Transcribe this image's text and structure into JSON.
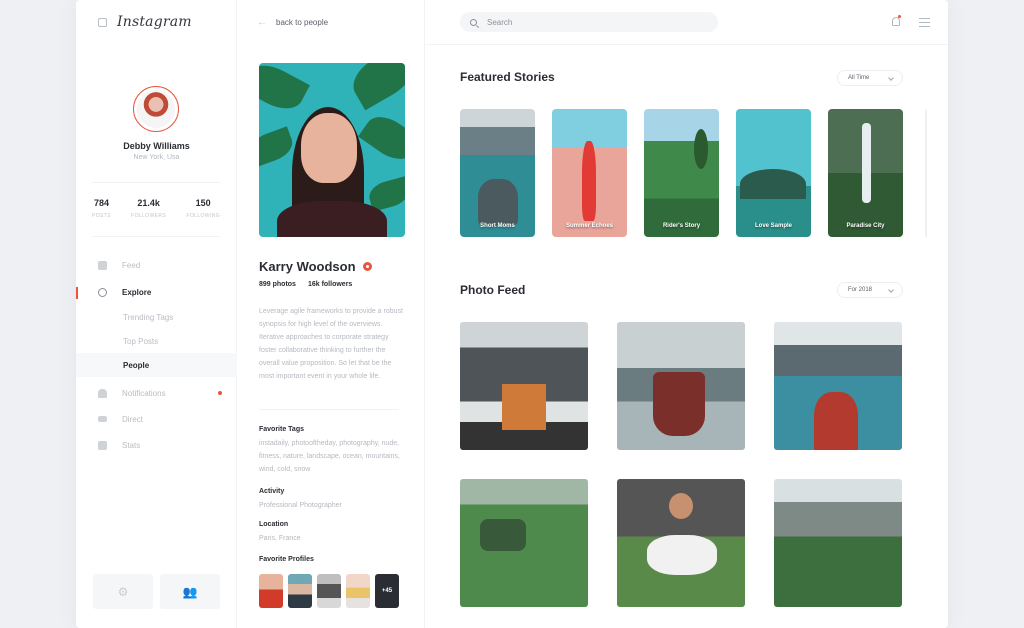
{
  "app": {
    "brand": "Instagram"
  },
  "user": {
    "name": "Debby Williams",
    "location": "New York, Usa"
  },
  "user_stats": [
    {
      "value": "784",
      "label": "POSTS"
    },
    {
      "value": "21.4k",
      "label": "FOLLOWERS"
    },
    {
      "value": "150",
      "label": "FOLLOWING"
    }
  ],
  "nav": {
    "feed": "Feed",
    "explore": "Explore",
    "trending": "Trending Tags",
    "top_posts": "Top Posts",
    "people": "People",
    "notifications": "Notifications",
    "direct": "Direct",
    "stats": "Stats"
  },
  "profile": {
    "back": "back to people",
    "name": "Karry Woodson",
    "photos": "899 photos",
    "followers": "16k followers",
    "bio": "Leverage agile frameworks to provide a robust synopsis for high level of the overviews. Iterative approaches to corporate strategy foster collaborative thinking to further the overall value proposition. So let that be the most important event in your whole life.",
    "favorite_tags_h": "Favorite Tags",
    "favorite_tags": "instadaily, photooftheday, photography, nude, fitness, nature,  landscape, ocean, mountains, wind, cold, snow",
    "activity_h": "Activity",
    "activity": "Professional Photographer",
    "location_h": "Location",
    "location": "Paris, France",
    "favorite_profiles_h": "Favorite Profiles",
    "more_profiles": "+45"
  },
  "search": {
    "placeholder": "Search"
  },
  "stories": {
    "title": "Featured Stories",
    "filter": "All Time",
    "items": [
      "Short Moms",
      "Summer Echoes",
      "Rider's Story",
      "Love Sample",
      "Paradise City"
    ]
  },
  "feed": {
    "title": "Photo Feed",
    "filter": "For 2018"
  },
  "colors": {
    "accent": "#e8573d"
  }
}
